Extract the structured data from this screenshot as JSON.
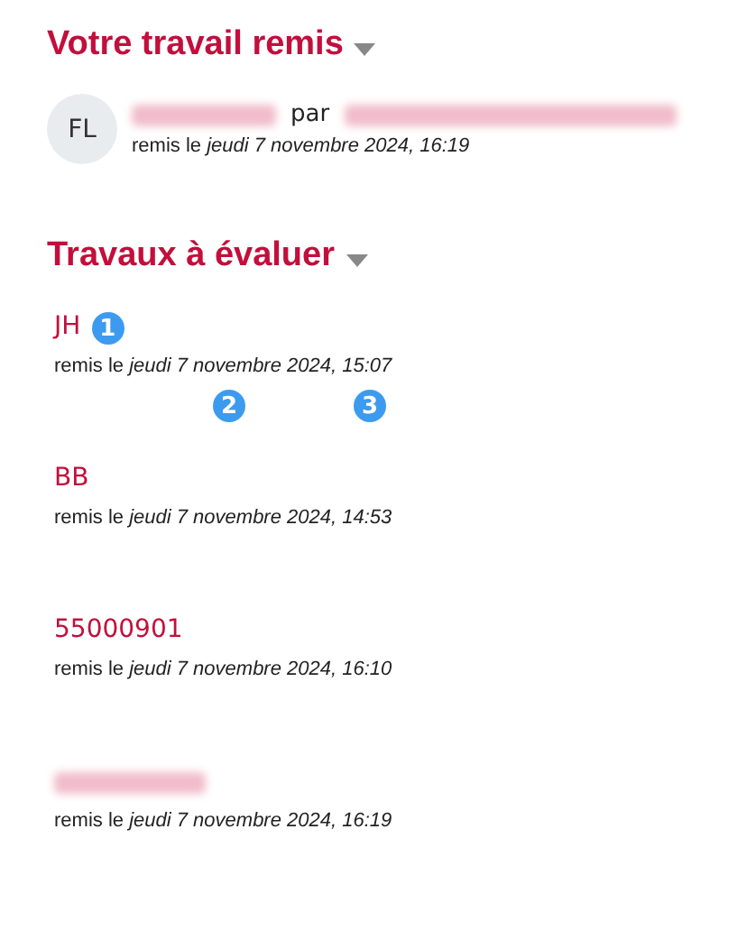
{
  "own_submission": {
    "heading": "Votre travail remis",
    "avatar": "FL",
    "author_redacted": true,
    "by": "par",
    "fullname_redacted": true,
    "date_prefix": "remis le",
    "date": "jeudi 7 novembre 2024, 16:19"
  },
  "to_grade": {
    "heading": "Travaux à évaluer",
    "items": [
      {
        "kind": "text",
        "name": "JH",
        "date_prefix": "remis le",
        "date": "jeudi 7 novembre 2024, 15:07",
        "markers": [
          {
            "kind": "name",
            "label": "1"
          },
          {
            "kind": "date",
            "label": "2"
          },
          {
            "kind": "time",
            "label": "3"
          }
        ]
      },
      {
        "kind": "text",
        "name": "BB",
        "date_prefix": "remis le",
        "date": "jeudi 7 novembre 2024, 14:53"
      },
      {
        "kind": "text",
        "name": "55000901",
        "date_prefix": "remis le",
        "date": "jeudi 7 novembre 2024, 16:10"
      },
      {
        "kind": "redacted",
        "date_prefix": "remis le",
        "date": "jeudi 7 novembre 2024, 16:19"
      }
    ]
  }
}
